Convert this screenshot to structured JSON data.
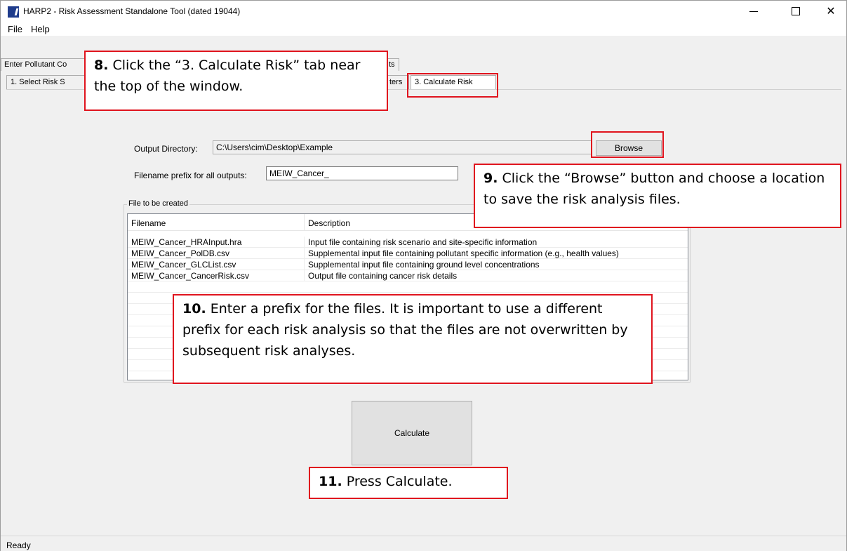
{
  "window": {
    "title": "HARP2 - Risk Assessment Standalone Tool (dated 19044)",
    "controls": {
      "minimize": "minimize-icon",
      "maximize": "maximize-icon",
      "close": "close-icon"
    }
  },
  "menu": [
    "File",
    "Help"
  ],
  "outer_tabs": [
    "Enter Pollutant Co",
    "ts"
  ],
  "inner_tabs": [
    "1. Select Risk S",
    "ters",
    "3. Calculate Risk"
  ],
  "form": {
    "output_dir_label": "Output Directory:",
    "output_dir_value": "C:\\Users\\cim\\Desktop\\Example",
    "browse_label": "Browse",
    "prefix_label": "Filename prefix for all outputs:",
    "prefix_value": "MEIW_Cancer_"
  },
  "files": {
    "group_title": "File to be created",
    "columns": [
      "Filename",
      "Description"
    ],
    "rows": [
      [
        "MEIW_Cancer_HRAInput.hra",
        "Input file containing risk scenario and site-specific information"
      ],
      [
        "MEIW_Cancer_PolDB.csv",
        "Supplemental input file containing pollutant specific information (e.g., health values)"
      ],
      [
        "MEIW_Cancer_GLCList.csv",
        "Supplemental input file containing ground level concentrations"
      ],
      [
        "MEIW_Cancer_CancerRisk.csv",
        "Output file containing cancer risk details"
      ]
    ]
  },
  "calculate_label": "Calculate",
  "status": "Ready",
  "callouts": {
    "c8": {
      "num": "8.",
      "text": " Click the “3. Calculate Risk” tab near the top of the window."
    },
    "c9": {
      "num": "9.",
      "text": " Click the “Browse” button and choose a location to save the risk analysis files."
    },
    "c10": {
      "num": "10.",
      "text": " Enter a prefix for the files.  It is important to use a different prefix for each risk analysis so that the files are not overwritten by subsequent risk analyses."
    },
    "c11": {
      "num": "11.",
      "text": " Press Calculate."
    }
  },
  "accent": "#e0141e"
}
